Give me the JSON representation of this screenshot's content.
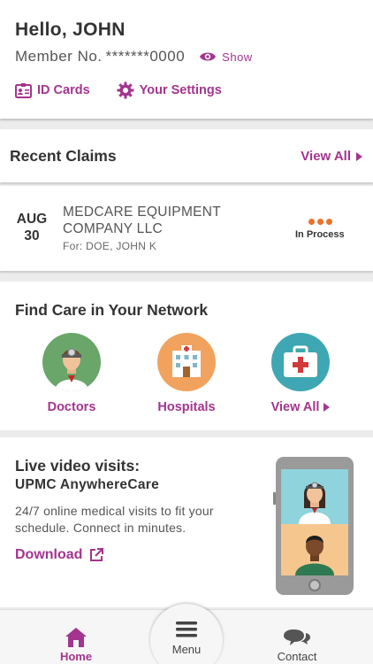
{
  "header": {
    "greeting": "Hello, JOHN",
    "member_label": "Member No.",
    "member_number": "*******0000",
    "show_label": "Show",
    "id_cards_label": "ID Cards",
    "settings_label": "Your Settings"
  },
  "claims": {
    "title": "Recent Claims",
    "view_all_label": "View All",
    "items": [
      {
        "month": "AUG",
        "day": "30",
        "provider": "MEDCARE EQUIPMENT COMPANY LLC",
        "patient": "For: DOE, JOHN K",
        "status": "In Process"
      }
    ]
  },
  "find_care": {
    "title": "Find Care in Your Network",
    "items": [
      {
        "label": "Doctors",
        "icon": "doctor-icon",
        "color": "#6aa56a"
      },
      {
        "label": "Hospitals",
        "icon": "hospital-icon",
        "color": "#f0a25e"
      },
      {
        "label": "View All",
        "icon": "first-aid-kit-icon",
        "color": "#3fa7b3"
      }
    ]
  },
  "video": {
    "title": "Live video visits:",
    "subtitle": "UPMC AnywhereCare",
    "description": "24/7 online medical visits to fit your schedule. Connect in minutes.",
    "download_label": "Download"
  },
  "tabbar": {
    "home_label": "Home",
    "menu_label": "Menu",
    "contact_label": "Contact"
  },
  "colors": {
    "accent": "#a3358f",
    "status_dots": "#e8722a"
  }
}
